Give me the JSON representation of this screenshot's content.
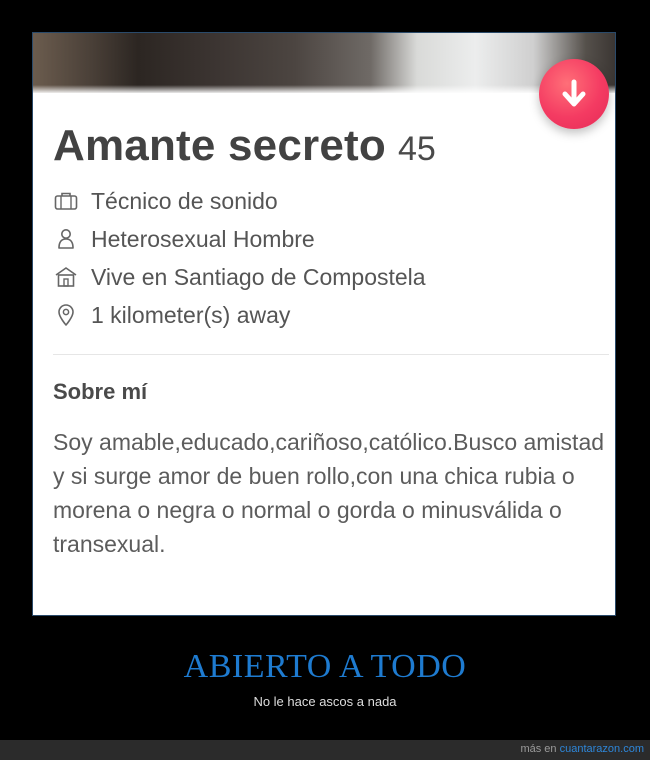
{
  "profile": {
    "name": "Amante secreto",
    "age": "45",
    "job": "Técnico de sonido",
    "orientation": "Heterosexual Hombre",
    "location": "Vive en Santiago de Compostela",
    "distance": "1 kilometer(s) away",
    "about_title": "Sobre mí",
    "about_text": "Soy amable,educado,cariñoso,católico.Busco amistad y si surge amor de buen rollo,con una chica rubia o morena o negra o normal o gorda o minusválida o transexual."
  },
  "icons": {
    "job": "briefcase-icon",
    "orientation": "person-icon",
    "location": "house-icon",
    "distance": "location-pin-icon",
    "collapse_button": "arrow-down-icon"
  },
  "caption": {
    "title": "ABIERTO A TODO",
    "subtitle": "No le hace ascos a nada"
  },
  "footer": {
    "prefix": "más en",
    "link": "cuantarazon.com"
  },
  "colors": {
    "accent_button": "#f43b62",
    "caption_title": "#1e7bd0",
    "footer_link": "#2e86d8"
  }
}
